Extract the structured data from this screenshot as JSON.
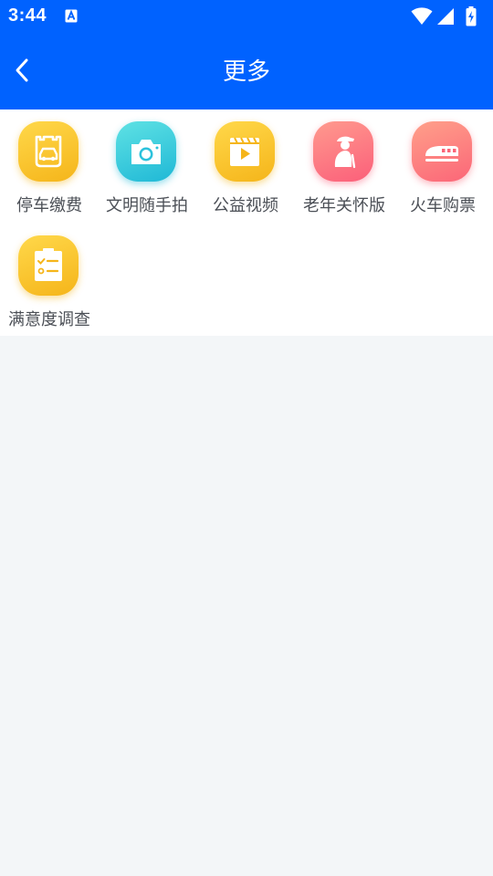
{
  "status_bar": {
    "time": "3:44",
    "icons": [
      "a-notification-icon",
      "wifi-icon",
      "signal-icon",
      "battery-charging-icon"
    ]
  },
  "app_bar": {
    "title": "更多",
    "back_icon": "back-arrow-icon"
  },
  "theme": {
    "primary": "#0062ff",
    "background": "#f3f6f8",
    "panel": "#ffffff",
    "label_text": "#4b4f56"
  },
  "grid": {
    "items": [
      {
        "label": "停车缴费",
        "icon": "parking-pay-icon"
      },
      {
        "label": "文明随手拍",
        "icon": "camera-icon"
      },
      {
        "label": "公益视频",
        "icon": "video-play-icon"
      },
      {
        "label": "老年关怀版",
        "icon": "elderly-icon"
      },
      {
        "label": "火车购票",
        "icon": "train-icon"
      },
      {
        "label": "满意度调查",
        "icon": "survey-clipboard-icon"
      }
    ]
  }
}
